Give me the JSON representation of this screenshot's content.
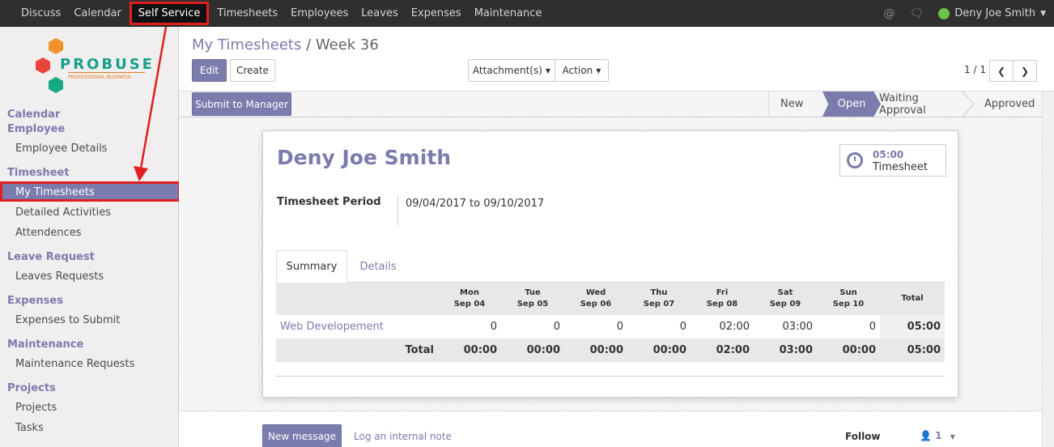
{
  "topbar": {
    "menu": [
      "Discuss",
      "Calendar",
      "Self Service",
      "Timesheets",
      "Employees",
      "Leaves",
      "Expenses",
      "Maintenance"
    ],
    "active_menu": "Self Service",
    "user": "Deny Joe Smith",
    "icons": [
      "at-icon",
      "chat-icon"
    ]
  },
  "sidebar": {
    "logo_text": "PROBUSE",
    "logo_tagline": "PROFESSIONAL BUSINESS",
    "sections": [
      {
        "label": "Calendar"
      },
      {
        "label": "Employee",
        "items": [
          "Employee Details"
        ]
      },
      {
        "label": "Timesheet",
        "items": [
          "My Timesheets",
          "Detailed Activities",
          "Attendences"
        ]
      },
      {
        "label": "Leave Request",
        "items": [
          "Leaves Requests"
        ]
      },
      {
        "label": "Expenses",
        "items": [
          "Expenses to Submit"
        ]
      },
      {
        "label": "Maintenance",
        "items": [
          "Maintenance Requests"
        ]
      },
      {
        "label": "Projects",
        "items": [
          "Projects",
          "Tasks"
        ]
      }
    ],
    "active_item": "My Timesheets"
  },
  "control_panel": {
    "breadcrumb_parent": "My Timesheets",
    "breadcrumb_sep": "/",
    "breadcrumb_current": "Week 36",
    "edit_label": "Edit",
    "create_label": "Create",
    "attachments_label": "Attachment(s)",
    "action_label": "Action",
    "pager": "1 / 1"
  },
  "statusbar": {
    "submit_label": "Submit to Manager",
    "stages": [
      "New",
      "Open",
      "Waiting Approval",
      "Approved"
    ],
    "current_stage": "Open"
  },
  "sheet": {
    "employee_name": "Deny Joe Smith",
    "smart_button": {
      "value": "05:00",
      "label": "Timesheet"
    },
    "period_label": "Timesheet Period",
    "period_value": "09/04/2017 to 09/10/2017",
    "tabs": [
      "Summary",
      "Details"
    ],
    "active_tab": "Summary",
    "table": {
      "days": [
        {
          "day": "Mon",
          "date": "Sep 04"
        },
        {
          "day": "Tue",
          "date": "Sep 05"
        },
        {
          "day": "Wed",
          "date": "Sep 06"
        },
        {
          "day": "Thu",
          "date": "Sep 07"
        },
        {
          "day": "Fri",
          "date": "Sep 08"
        },
        {
          "day": "Sat",
          "date": "Sep 09"
        },
        {
          "day": "Sun",
          "date": "Sep 10"
        }
      ],
      "total_header": "Total",
      "rows": [
        {
          "name": "Web Developement",
          "values": [
            "0",
            "0",
            "0",
            "0",
            "02:00",
            "03:00",
            "0"
          ],
          "total": "05:00"
        }
      ],
      "footer_label": "Total",
      "footer_values": [
        "00:00",
        "00:00",
        "00:00",
        "00:00",
        "02:00",
        "03:00",
        "00:00"
      ],
      "footer_total": "05:00"
    }
  },
  "chatter": {
    "new_message_label": "New message",
    "log_note_label": "Log an internal note",
    "follow_label": "Follow",
    "followers_count": "1"
  },
  "colors": {
    "accent": "#7c7bad",
    "annotation": "#e02020"
  }
}
